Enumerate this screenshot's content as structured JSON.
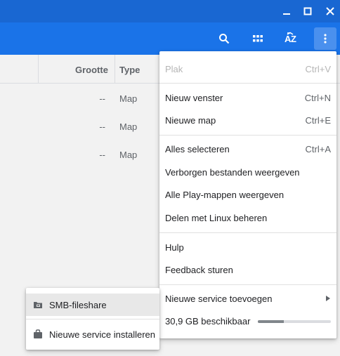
{
  "toolbar": {
    "search_icon": "search-icon",
    "grid_icon": "grid-view-icon",
    "sort_icon": "sort-az-icon",
    "more_icon": "more-vert-icon"
  },
  "columns": {
    "size": "Grootte",
    "type": "Type"
  },
  "rows": [
    {
      "size": "--",
      "type": "Map"
    },
    {
      "size": "--",
      "type": "Map"
    },
    {
      "size": "--",
      "type": "Map"
    }
  ],
  "menu": {
    "paste": {
      "label": "Plak",
      "shortcut": "Ctrl+V"
    },
    "new_window": {
      "label": "Nieuw venster",
      "shortcut": "Ctrl+N"
    },
    "new_folder": {
      "label": "Nieuwe map",
      "shortcut": "Ctrl+E"
    },
    "select_all": {
      "label": "Alles selecteren",
      "shortcut": "Ctrl+A"
    },
    "show_hidden": {
      "label": "Verborgen bestanden weergeven"
    },
    "play_folders": {
      "label": "Alle Play-mappen weergeven"
    },
    "linux_share": {
      "label": "Delen met Linux beheren"
    },
    "help": {
      "label": "Hulp"
    },
    "feedback": {
      "label": "Feedback sturen"
    },
    "add_service": {
      "label": "Nieuwe service toevoegen"
    },
    "storage": {
      "label": "30,9 GB beschikbaar",
      "used_fraction": 0.36
    }
  },
  "submenu": {
    "smb": {
      "label": "SMB-fileshare"
    },
    "install": {
      "label": "Nieuwe service installeren"
    }
  },
  "colors": {
    "titlebar": "#1967d2",
    "toolbar": "#1a73e8",
    "menu_bg": "#ffffff",
    "highlight": "#e8e8e8"
  }
}
